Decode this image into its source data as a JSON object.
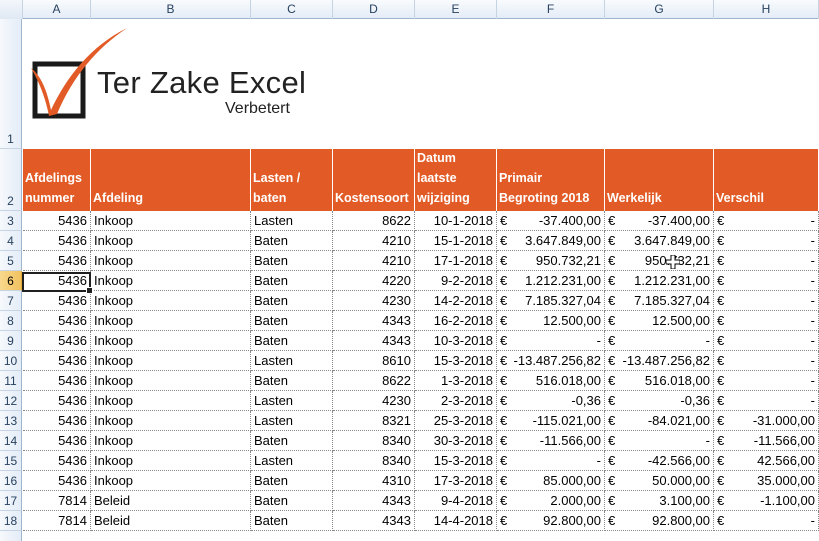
{
  "columns": [
    "A",
    "B",
    "C",
    "D",
    "E",
    "F",
    "G",
    "H"
  ],
  "logo": {
    "brand": "Ter Zake Excel",
    "tagline": "Verbetert",
    "accent": "#e25b26"
  },
  "header_row_number": "1",
  "header_row2_number": "2",
  "headers": [
    "Afdelings\nnummer",
    "Afdeling",
    "Lasten /\nbaten",
    "Kostensoort",
    "Datum\nlaatste\nwijziging",
    "Primair\nBegroting 2018",
    "Werkelijk",
    "Verschil"
  ],
  "selected_row": "6",
  "rows": [
    {
      "n": "3",
      "a": "5436",
      "b": "Inkoop",
      "c": "Lasten",
      "d": "8622",
      "e": "10-1-2018",
      "f": "-37.400,00",
      "g": "-37.400,00",
      "h": "-"
    },
    {
      "n": "4",
      "a": "5436",
      "b": "Inkoop",
      "c": "Baten",
      "d": "4210",
      "e": "15-1-2018",
      "f": "3.647.849,00",
      "g": "3.647.849,00",
      "h": "-"
    },
    {
      "n": "5",
      "a": "5436",
      "b": "Inkoop",
      "c": "Baten",
      "d": "4210",
      "e": "17-1-2018",
      "f": "950.732,21",
      "g": "950.732,21",
      "h": "-"
    },
    {
      "n": "6",
      "a": "5436",
      "b": "Inkoop",
      "c": "Baten",
      "d": "4220",
      "e": "9-2-2018",
      "f": "1.212.231,00",
      "g": "1.212.231,00",
      "h": "-"
    },
    {
      "n": "7",
      "a": "5436",
      "b": "Inkoop",
      "c": "Baten",
      "d": "4230",
      "e": "14-2-2018",
      "f": "7.185.327,04",
      "g": "7.185.327,04",
      "h": "-"
    },
    {
      "n": "8",
      "a": "5436",
      "b": "Inkoop",
      "c": "Baten",
      "d": "4343",
      "e": "16-2-2018",
      "f": "12.500,00",
      "g": "12.500,00",
      "h": "-"
    },
    {
      "n": "9",
      "a": "5436",
      "b": "Inkoop",
      "c": "Baten",
      "d": "4343",
      "e": "10-3-2018",
      "f": "-",
      "g": "-",
      "h": "-"
    },
    {
      "n": "10",
      "a": "5436",
      "b": "Inkoop",
      "c": "Lasten",
      "d": "8610",
      "e": "15-3-2018",
      "f": "-13.487.256,82",
      "g": "-13.487.256,82",
      "h": "-"
    },
    {
      "n": "11",
      "a": "5436",
      "b": "Inkoop",
      "c": "Baten",
      "d": "8622",
      "e": "1-3-2018",
      "f": "516.018,00",
      "g": "516.018,00",
      "h": "-"
    },
    {
      "n": "12",
      "a": "5436",
      "b": "Inkoop",
      "c": "Lasten",
      "d": "4230",
      "e": "2-3-2018",
      "f": "-0,36",
      "g": "-0,36",
      "h": "-"
    },
    {
      "n": "13",
      "a": "5436",
      "b": "Inkoop",
      "c": "Lasten",
      "d": "8321",
      "e": "25-3-2018",
      "f": "-115.021,00",
      "g": "-84.021,00",
      "h": "-31.000,00"
    },
    {
      "n": "14",
      "a": "5436",
      "b": "Inkoop",
      "c": "Baten",
      "d": "8340",
      "e": "30-3-2018",
      "f": "-11.566,00",
      "g": "-",
      "h": "-11.566,00"
    },
    {
      "n": "15",
      "a": "5436",
      "b": "Inkoop",
      "c": "Lasten",
      "d": "8340",
      "e": "15-3-2018",
      "f": "-",
      "g": "-42.566,00",
      "h": "42.566,00"
    },
    {
      "n": "16",
      "a": "5436",
      "b": "Inkoop",
      "c": "Baten",
      "d": "4310",
      "e": "17-3-2018",
      "f": "85.000,00",
      "g": "50.000,00",
      "h": "35.000,00"
    },
    {
      "n": "17",
      "a": "7814",
      "b": "Beleid",
      "c": "Baten",
      "d": "4343",
      "e": "9-4-2018",
      "f": "2.000,00",
      "g": "3.100,00",
      "h": "-1.100,00"
    },
    {
      "n": "18",
      "a": "7814",
      "b": "Beleid",
      "c": "Baten",
      "d": "4343",
      "e": "14-4-2018",
      "f": "92.800,00",
      "g": "92.800,00",
      "h": "-"
    }
  ],
  "currency": "€"
}
